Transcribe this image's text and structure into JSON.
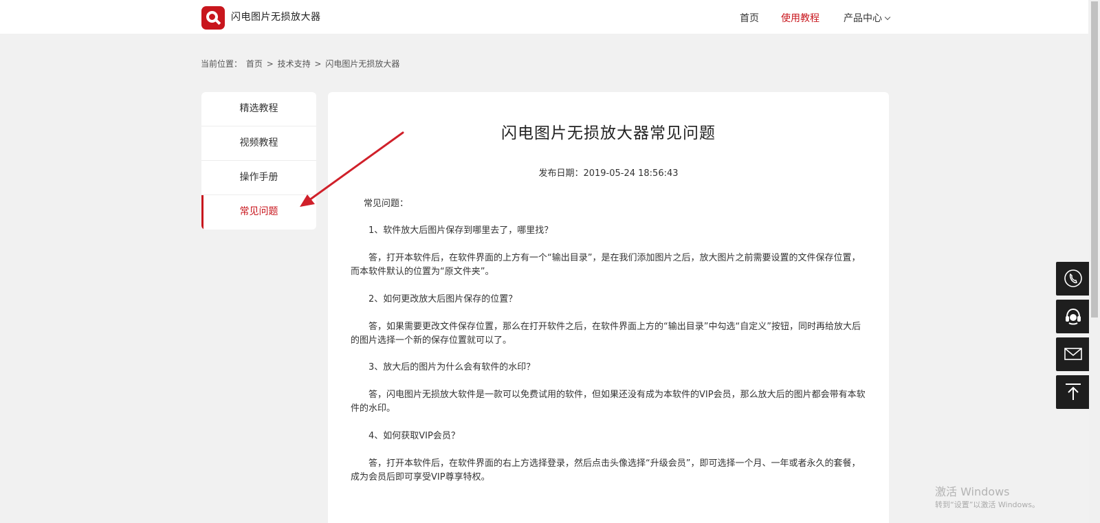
{
  "header": {
    "brand": "闪电图片无损放大器",
    "nav": [
      {
        "label": "首页"
      },
      {
        "label": "使用教程"
      },
      {
        "label": "产品中心"
      }
    ]
  },
  "breadcrumb": {
    "prefix": "当前位置：",
    "items": [
      "首页",
      "技术支持",
      "闪电图片无损放大器"
    ],
    "separator": ">"
  },
  "sidebar": {
    "items": [
      {
        "label": "精选教程"
      },
      {
        "label": "视频教程"
      },
      {
        "label": "操作手册"
      },
      {
        "label": "常见问题"
      }
    ]
  },
  "article": {
    "title": "闪电图片无损放大器常见问题",
    "date": "发布日期：2019-05-24 18:56:43",
    "paragraphs": [
      "常见问题：",
      "1、软件放大后图片保存到哪里去了，哪里找？",
      "答，打开本软件后，在软件界面的上方有一个“输出目录”，是在我们添加图片之后，放大图片之前需要设置的文件保存位置，而本软件默认的位置为“原文件夹”。",
      "2、如何更改放大后图片保存的位置？",
      "答，如果需要更改文件保存位置，那么在打开软件之后，在软件界面上方的“输出目录”中勾选“自定义”按钮，同时再给放大后的图片选择一个新的保存位置就可以了。",
      "3、放大后的图片为什么会有软件的水印？",
      "答，闪电图片无损放大软件是一款可以免费试用的软件，但如果还没有成为本软件的VIP会员，那么放大后的图片都会带有本软件的水印。",
      "4、如何获取VIP会员？",
      "答，打开本软件后，在软件界面的右上方选择登录，然后点击头像选择“升级会员”，即可选择一个月、一年或者永久的套餐，成为会员后即可享受VIP尊享特权。"
    ]
  },
  "watermark": {
    "line1": "激活 Windows",
    "line2": "转到“设置”以激活 Windows。"
  },
  "colors": {
    "accent": "#c8161d",
    "annotation_arrow": "#d0202a",
    "float_bg": "#1e1e1e"
  },
  "icons": [
    "phone-icon",
    "headset-icon",
    "mail-icon",
    "back-to-top-icon"
  ]
}
